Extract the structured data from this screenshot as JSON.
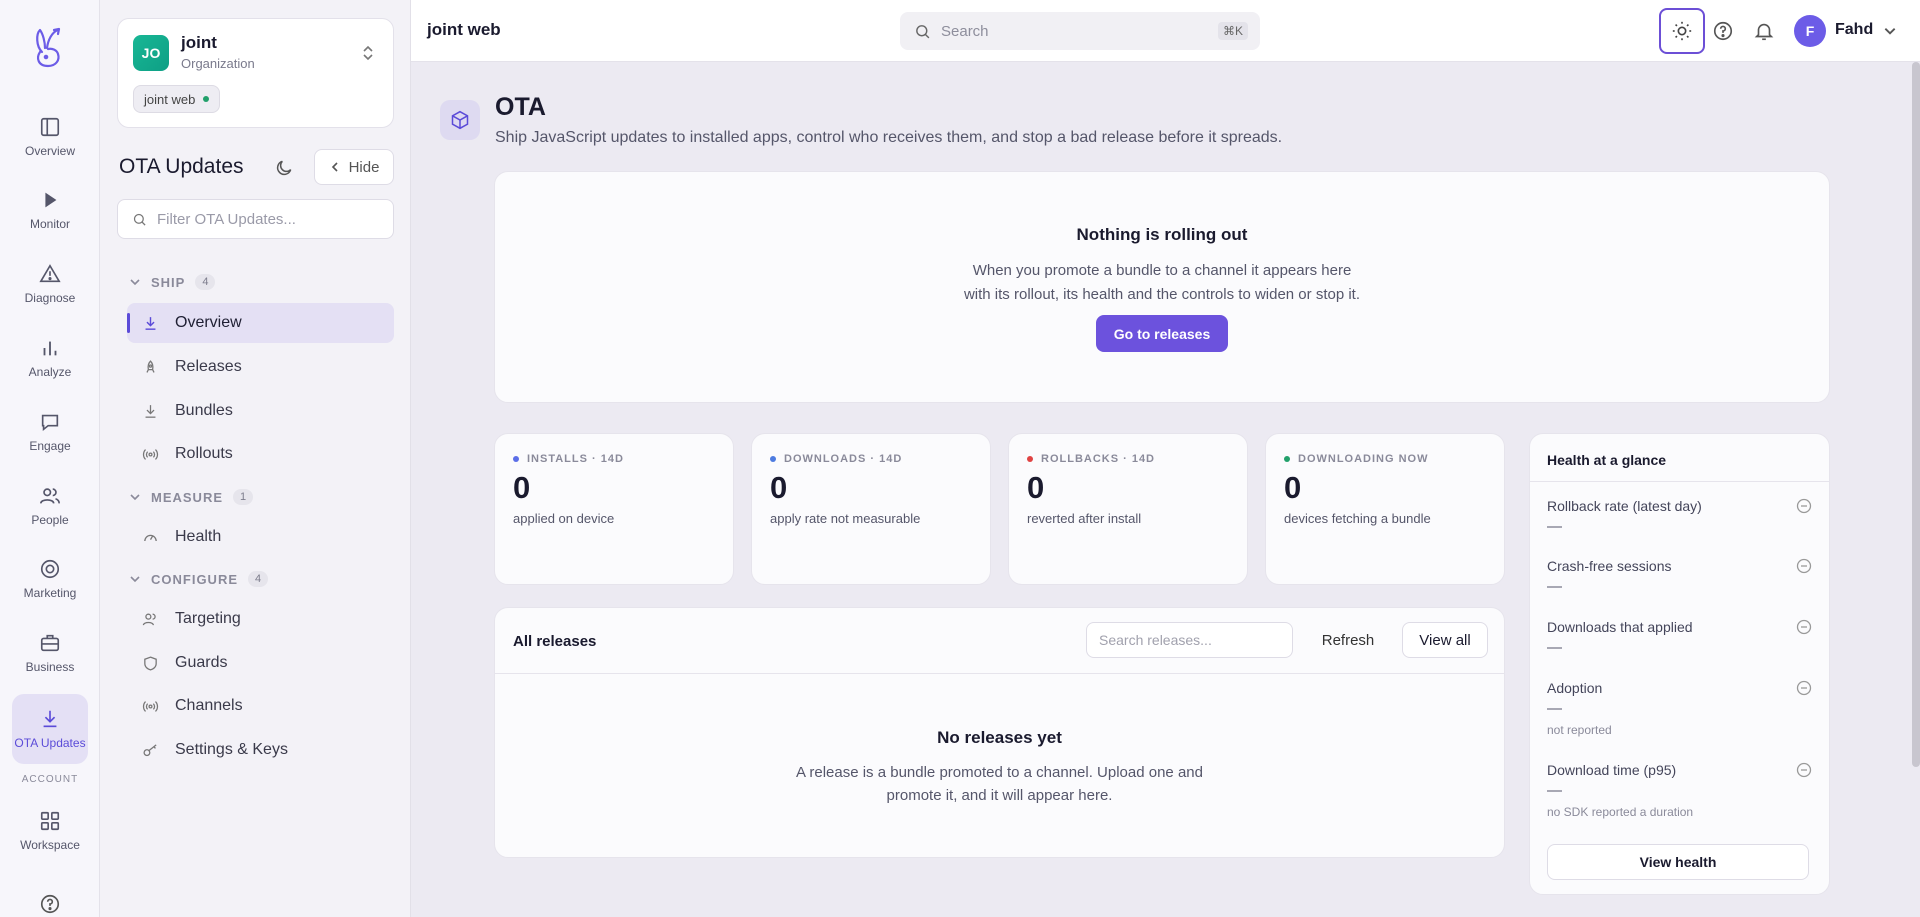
{
  "rail": {
    "items": [
      {
        "label": "Overview",
        "icon": "layout-icon"
      },
      {
        "label": "Monitor",
        "icon": "play-icon"
      },
      {
        "label": "Diagnose",
        "icon": "warning-icon"
      },
      {
        "label": "Analyze",
        "icon": "bar-chart-icon"
      },
      {
        "label": "Engage",
        "icon": "chat-icon"
      },
      {
        "label": "People",
        "icon": "users-icon"
      },
      {
        "label": "Marketing",
        "icon": "target-icon"
      },
      {
        "label": "Business",
        "icon": "briefcase-icon"
      },
      {
        "label": "OTA Updates",
        "icon": "download-icon"
      }
    ],
    "account_section": "ACCOUNT",
    "workspace": {
      "label": "Workspace",
      "icon": "grid-icon"
    }
  },
  "org": {
    "initials": "JO",
    "name": "joint",
    "type": "Organization",
    "project_chip": "joint web"
  },
  "panel": {
    "title": "OTA Updates",
    "hide_label": "Hide",
    "filter_placeholder": "Filter OTA Updates...",
    "groups": [
      {
        "name": "SHIP",
        "count": "4",
        "items": [
          "Overview",
          "Releases",
          "Bundles",
          "Rollouts"
        ]
      },
      {
        "name": "MEASURE",
        "count": "1",
        "items": [
          "Health"
        ]
      },
      {
        "name": "CONFIGURE",
        "count": "4",
        "items": [
          "Targeting",
          "Guards",
          "Channels",
          "Settings & Keys"
        ]
      }
    ]
  },
  "topbar": {
    "project": "joint web",
    "search_placeholder": "Search",
    "shortcut": "⌘K",
    "user_initial": "F",
    "user_name": "Fahd"
  },
  "page": {
    "title": "OTA",
    "subtitle": "Ship JavaScript updates to installed apps, control who receives them, and stop a bad release before it spreads."
  },
  "hero": {
    "title": "Nothing is rolling out",
    "line1": "When you promote a bundle to a channel it appears here",
    "line2": "with its rollout, its health and the controls to widen or stop it.",
    "button": "Go to releases"
  },
  "stats": [
    {
      "label": "INSTALLS · 14D",
      "value": "0",
      "caption": "applied on device",
      "color": "#5b6ee8"
    },
    {
      "label": "DOWNLOADS · 14D",
      "value": "0",
      "caption": "apply rate not measurable",
      "color": "#4d7be0"
    },
    {
      "label": "ROLLBACKS · 14D",
      "value": "0",
      "caption": "reverted after install",
      "color": "#e04343"
    },
    {
      "label": "DOWNLOADING NOW",
      "value": "0",
      "caption": "devices fetching a bundle",
      "color": "#22a06b"
    }
  ],
  "releases": {
    "title": "All releases",
    "search_placeholder": "Search releases...",
    "refresh": "Refresh",
    "view_all": "View all",
    "empty_title": "No releases yet",
    "empty_line1": "A release is a bundle promoted to a channel. Upload one and",
    "empty_line2": "promote it, and it will appear here."
  },
  "health": {
    "title": "Health at a glance",
    "rows": [
      {
        "name": "Rollback rate (latest day)",
        "value": "—",
        "note": ""
      },
      {
        "name": "Crash-free sessions",
        "value": "—",
        "note": ""
      },
      {
        "name": "Downloads that applied",
        "value": "—",
        "note": ""
      },
      {
        "name": "Adoption",
        "value": "—",
        "note": "not reported"
      },
      {
        "name": "Download time (p95)",
        "value": "—",
        "note": "no SDK reported a duration"
      }
    ],
    "button": "View health"
  }
}
